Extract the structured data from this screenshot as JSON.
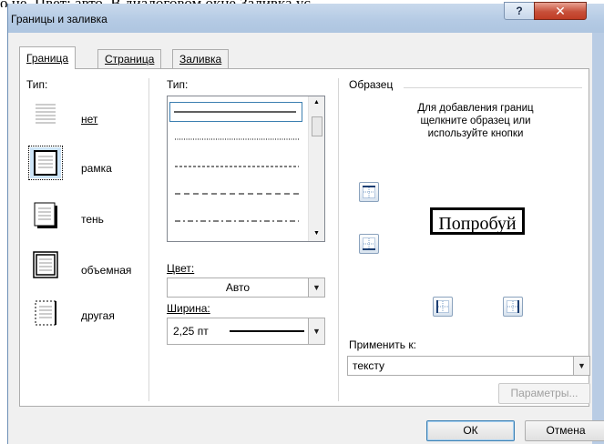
{
  "background": {
    "doc_text": "о не, Цвет: авто. В диалоговом окне Заливка ус"
  },
  "window": {
    "title": "Границы и заливка",
    "help": "?",
    "close": "✕"
  },
  "tabs": [
    {
      "label": "Граница",
      "active": true
    },
    {
      "label": "Страница",
      "active": false
    },
    {
      "label": "Заливка",
      "active": false
    }
  ],
  "type_section": {
    "label": "Тип:",
    "presets": [
      {
        "label": "нет",
        "icon": "border-none-icon"
      },
      {
        "label": "рамка",
        "icon": "border-box-icon",
        "selected": true
      },
      {
        "label": "тень",
        "icon": "border-shadow-icon"
      },
      {
        "label": "объемная",
        "icon": "border-3d-icon"
      },
      {
        "label": "другая",
        "icon": "border-custom-icon"
      }
    ]
  },
  "style_section": {
    "label": "Тип:",
    "styles": [
      "solid",
      "dotted",
      "dash-small",
      "dash",
      "dash-dot"
    ]
  },
  "color": {
    "label": "Цвет:",
    "value": "Авто"
  },
  "width": {
    "label": "Ширина:",
    "value": "2,25 пт"
  },
  "preview": {
    "label": "Образец",
    "hint": "Для добавления границ щелкните образец или используйте кнопки",
    "sample_text": "Попробуй"
  },
  "apply": {
    "label": "Применить к:",
    "value": "тексту"
  },
  "buttons": {
    "options": "Параметры...",
    "ok": "ОК",
    "cancel": "Отмена"
  },
  "colors": {
    "accent": "#3c7fb1",
    "title_gradient": "#b4cae4",
    "close_red": "#c7503a"
  }
}
